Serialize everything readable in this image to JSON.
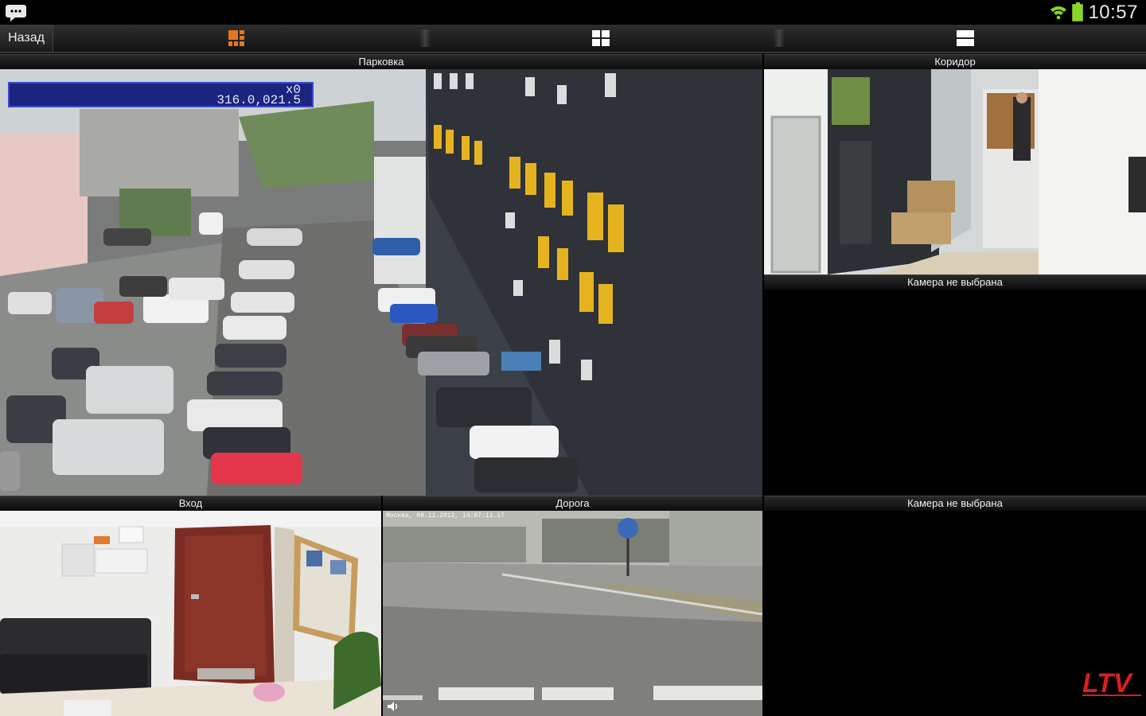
{
  "statusbar": {
    "time": "10:57"
  },
  "toolbar": {
    "back_label": "Назад",
    "tabs": [
      {
        "icon": "grid-mixed-icon",
        "color": "#e8741c",
        "active": true
      },
      {
        "icon": "grid-four-icon",
        "color": "#ffffff",
        "active": false
      },
      {
        "icon": "rows-two-icon",
        "color": "#ffffff",
        "active": false
      }
    ]
  },
  "cameras": {
    "parking": {
      "title": "Парковка",
      "osd_line1": "x0",
      "osd_line2": "316.0,021.5"
    },
    "corridor": {
      "title": "Коридор"
    },
    "empty1": {
      "title": "Камера не выбрана"
    },
    "entrance": {
      "title": "Вход"
    },
    "road": {
      "title": "Дорога",
      "timestamp": "Москва, 09.11.2012, 14:07:11.17"
    },
    "empty2": {
      "title": "Камера не выбрана"
    }
  },
  "brand": {
    "logo": "LTV"
  }
}
